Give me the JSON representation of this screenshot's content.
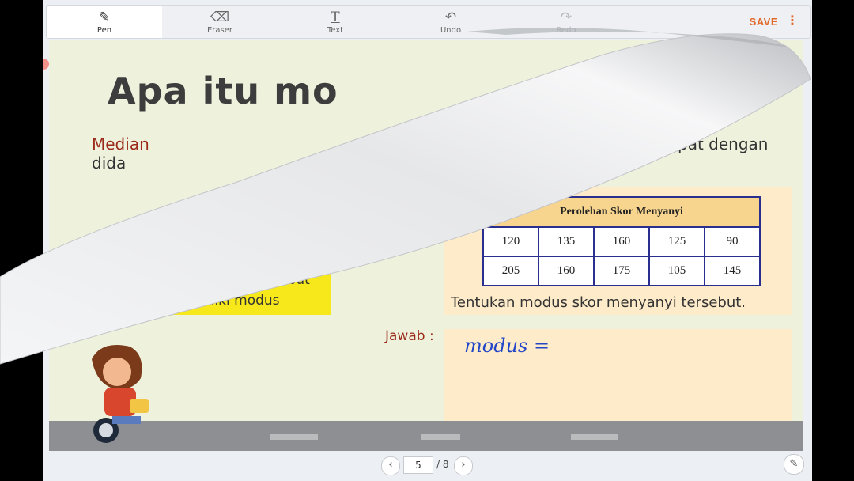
{
  "toolbar": {
    "tools": [
      {
        "label": "Pen",
        "icon": "pen-icon"
      },
      {
        "label": "Eraser",
        "icon": "eraser-icon"
      },
      {
        "label": "Text",
        "icon": "text-icon"
      },
      {
        "label": "Undo",
        "icon": "undo-icon"
      },
      {
        "label": "Redo",
        "icon": "redo-icon"
      }
    ],
    "save_label": "SAVE",
    "more_icon": "more-vertical-icon",
    "accent": "#e2692a"
  },
  "slide": {
    "title": "Apa itu mo",
    "median_text": "Median",
    "dida_text": "dida",
    "dengan_text": "pat dengan",
    "yellow_box": {
      "line1": "u tersebut",
      "line2": "iliki modus"
    },
    "table": {
      "header": "Perolehan Skor Menyanyi",
      "rows": [
        [
          "120",
          "135",
          "160",
          "125",
          "90"
        ],
        [
          "205",
          "160",
          "175",
          "105",
          "145"
        ]
      ]
    },
    "question": "Tentukan modus skor menyanyi tersebut.",
    "jawab_label": "Jawab :",
    "handwriting": "modus ="
  },
  "pager": {
    "current_page": "5",
    "total": "/ 8",
    "prev_icon": "chevron-left-icon",
    "next_icon": "chevron-right-icon",
    "edit_icon": "edit-page-icon"
  }
}
